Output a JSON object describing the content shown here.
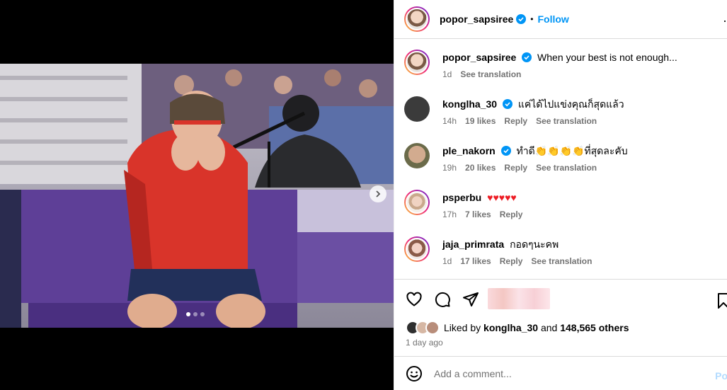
{
  "header": {
    "username": "popor_sapsiree",
    "separator": "•",
    "follow_label": "Follow"
  },
  "caption": {
    "username": "popor_sapsiree",
    "text": "When your best is not enough...",
    "time": "1d",
    "translate": "See translation"
  },
  "comments": [
    {
      "username": "konglha_30",
      "verified": true,
      "text": "แค่ได้ไปแข่งคุณก็สุดแล้ว",
      "time": "14h",
      "likes": "19 likes",
      "reply": "Reply",
      "translate": "See translation"
    },
    {
      "username": "ple_nakorn",
      "verified": true,
      "text": "ทำดี👏👏👏👏ที่สุดละคับ",
      "time": "19h",
      "likes": "20 likes",
      "reply": "Reply",
      "translate": "See translation"
    },
    {
      "username": "psperbu",
      "verified": false,
      "text": "♥♥♥♥♥",
      "time": "17h",
      "likes": "7 likes",
      "reply": "Reply",
      "translate": ""
    },
    {
      "username": "jaja_primrata",
      "verified": false,
      "text": "กอดๆนะคพ",
      "time": "1d",
      "likes": "17 likes",
      "reply": "Reply",
      "translate": "See translation"
    }
  ],
  "likes": {
    "prefix": "Liked by",
    "user": "konglha_30",
    "conj": "and",
    "others": "148,565 others"
  },
  "posted": "1 day ago",
  "add_comment": {
    "placeholder": "Add a comment...",
    "post_label": "Po"
  },
  "colors": {
    "accent": "#0095f6",
    "verified": "#0095f6",
    "heart": "#ed1c24",
    "muted": "#737373"
  },
  "carousel": {
    "slide_count": 3,
    "active_index": 0
  }
}
